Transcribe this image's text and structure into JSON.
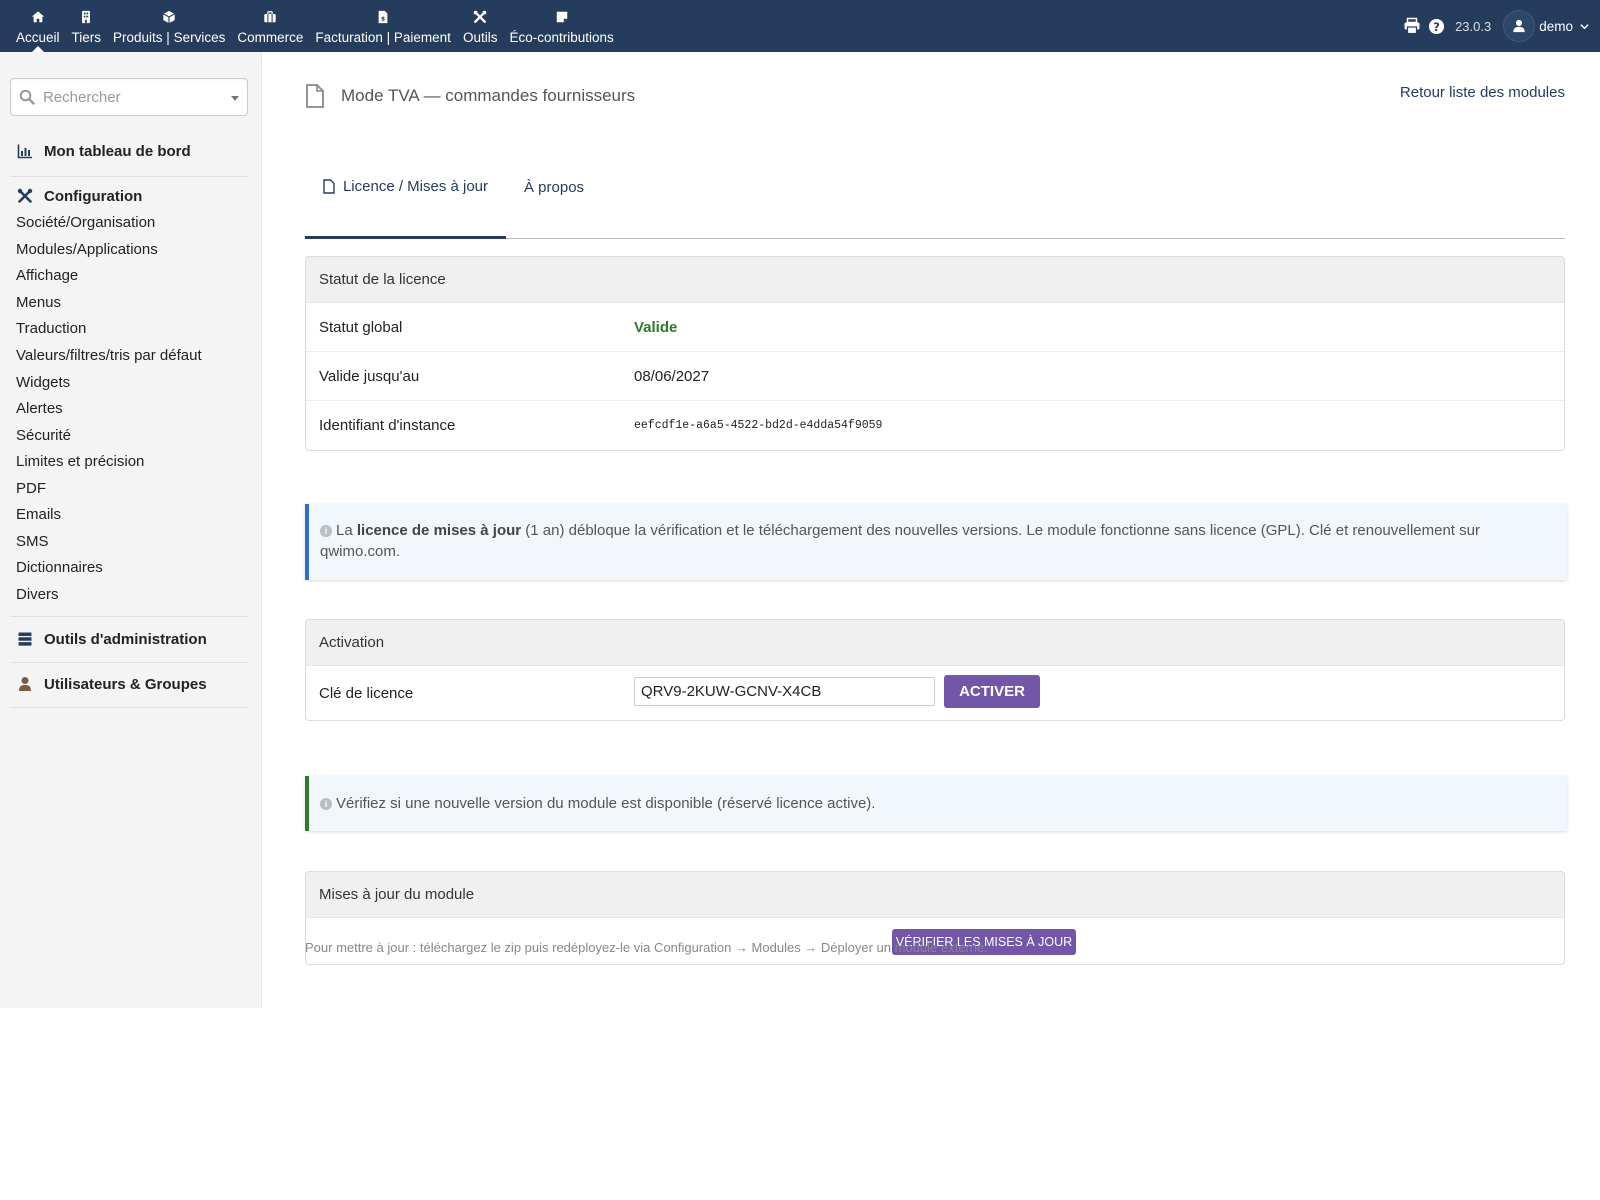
{
  "topnav": {
    "items": [
      {
        "label": "Accueil",
        "icon": "home-icon"
      },
      {
        "label": "Tiers",
        "icon": "building-icon"
      },
      {
        "label": "Produits | Services",
        "icon": "cube-icon"
      },
      {
        "label": "Commerce",
        "icon": "briefcase-icon"
      },
      {
        "label": "Facturation | Paiement",
        "icon": "invoice-icon"
      },
      {
        "label": "Outils",
        "icon": "tools-icon"
      },
      {
        "label": "Éco-contributions",
        "icon": "note-icon"
      }
    ],
    "active_index": 0
  },
  "header_right": {
    "version": "23.0.3",
    "username": "demo"
  },
  "sidebar": {
    "search_placeholder": "Rechercher",
    "dashboard": "Mon tableau de bord",
    "configuration": "Configuration",
    "config_items": [
      "Société/Organisation",
      "Modules/Applications",
      "Affichage",
      "Menus",
      "Traduction",
      "Valeurs/filtres/tris par défaut",
      "Widgets",
      "Alertes",
      "Sécurité",
      "Limites et précision",
      "PDF",
      "Emails",
      "SMS",
      "Dictionnaires",
      "Divers"
    ],
    "admin_tools": "Outils d'administration",
    "users_groups": "Utilisateurs & Groupes"
  },
  "page": {
    "title": "Mode TVA — commandes fournisseurs",
    "back_link": "Retour liste des modules",
    "tabs": [
      "Licence / Mises à jour",
      "À propos"
    ],
    "active_tab": 0
  },
  "license_status": {
    "heading": "Statut de la licence",
    "rows": [
      {
        "key": "Statut global",
        "value": "Valide"
      },
      {
        "key": "Valide jusqu'au",
        "value": "08/06/2027"
      },
      {
        "key": "Identifiant d'instance",
        "value": "eefcdf1e-a6a5-4522-bd2d-e4dda54f9059"
      }
    ],
    "status_color": "#2c7a2c"
  },
  "info_notice": {
    "prefix": "La ",
    "bold": "licence de mises à jour",
    "suffix": " (1 an) débloque la vérification et le téléchargement des nouvelles versions. Le module fonctionne sans licence (GPL). Clé et renouvellement sur qwimo.com."
  },
  "activation": {
    "heading": "Activation",
    "key_label": "Clé de licence",
    "key_value": "QRV9-2KUW-GCNV-X4CB",
    "button": "ACTIVER"
  },
  "version_notice": "Vérifiez si une nouvelle version du module est disponible (réservé licence active).",
  "updates": {
    "heading": "Mises à jour du module",
    "button": "VÉRIFIER LES MISES À JOUR"
  },
  "footnote": "Pour mettre à jour : téléchargez le zip puis redéployez-le via Configuration → Modules → Déployer un module externe.",
  "colors": {
    "topbar": "#263c5c",
    "button": "#7256a8",
    "info_border": "#2f6fc4",
    "success_border": "#2f7a2f"
  }
}
